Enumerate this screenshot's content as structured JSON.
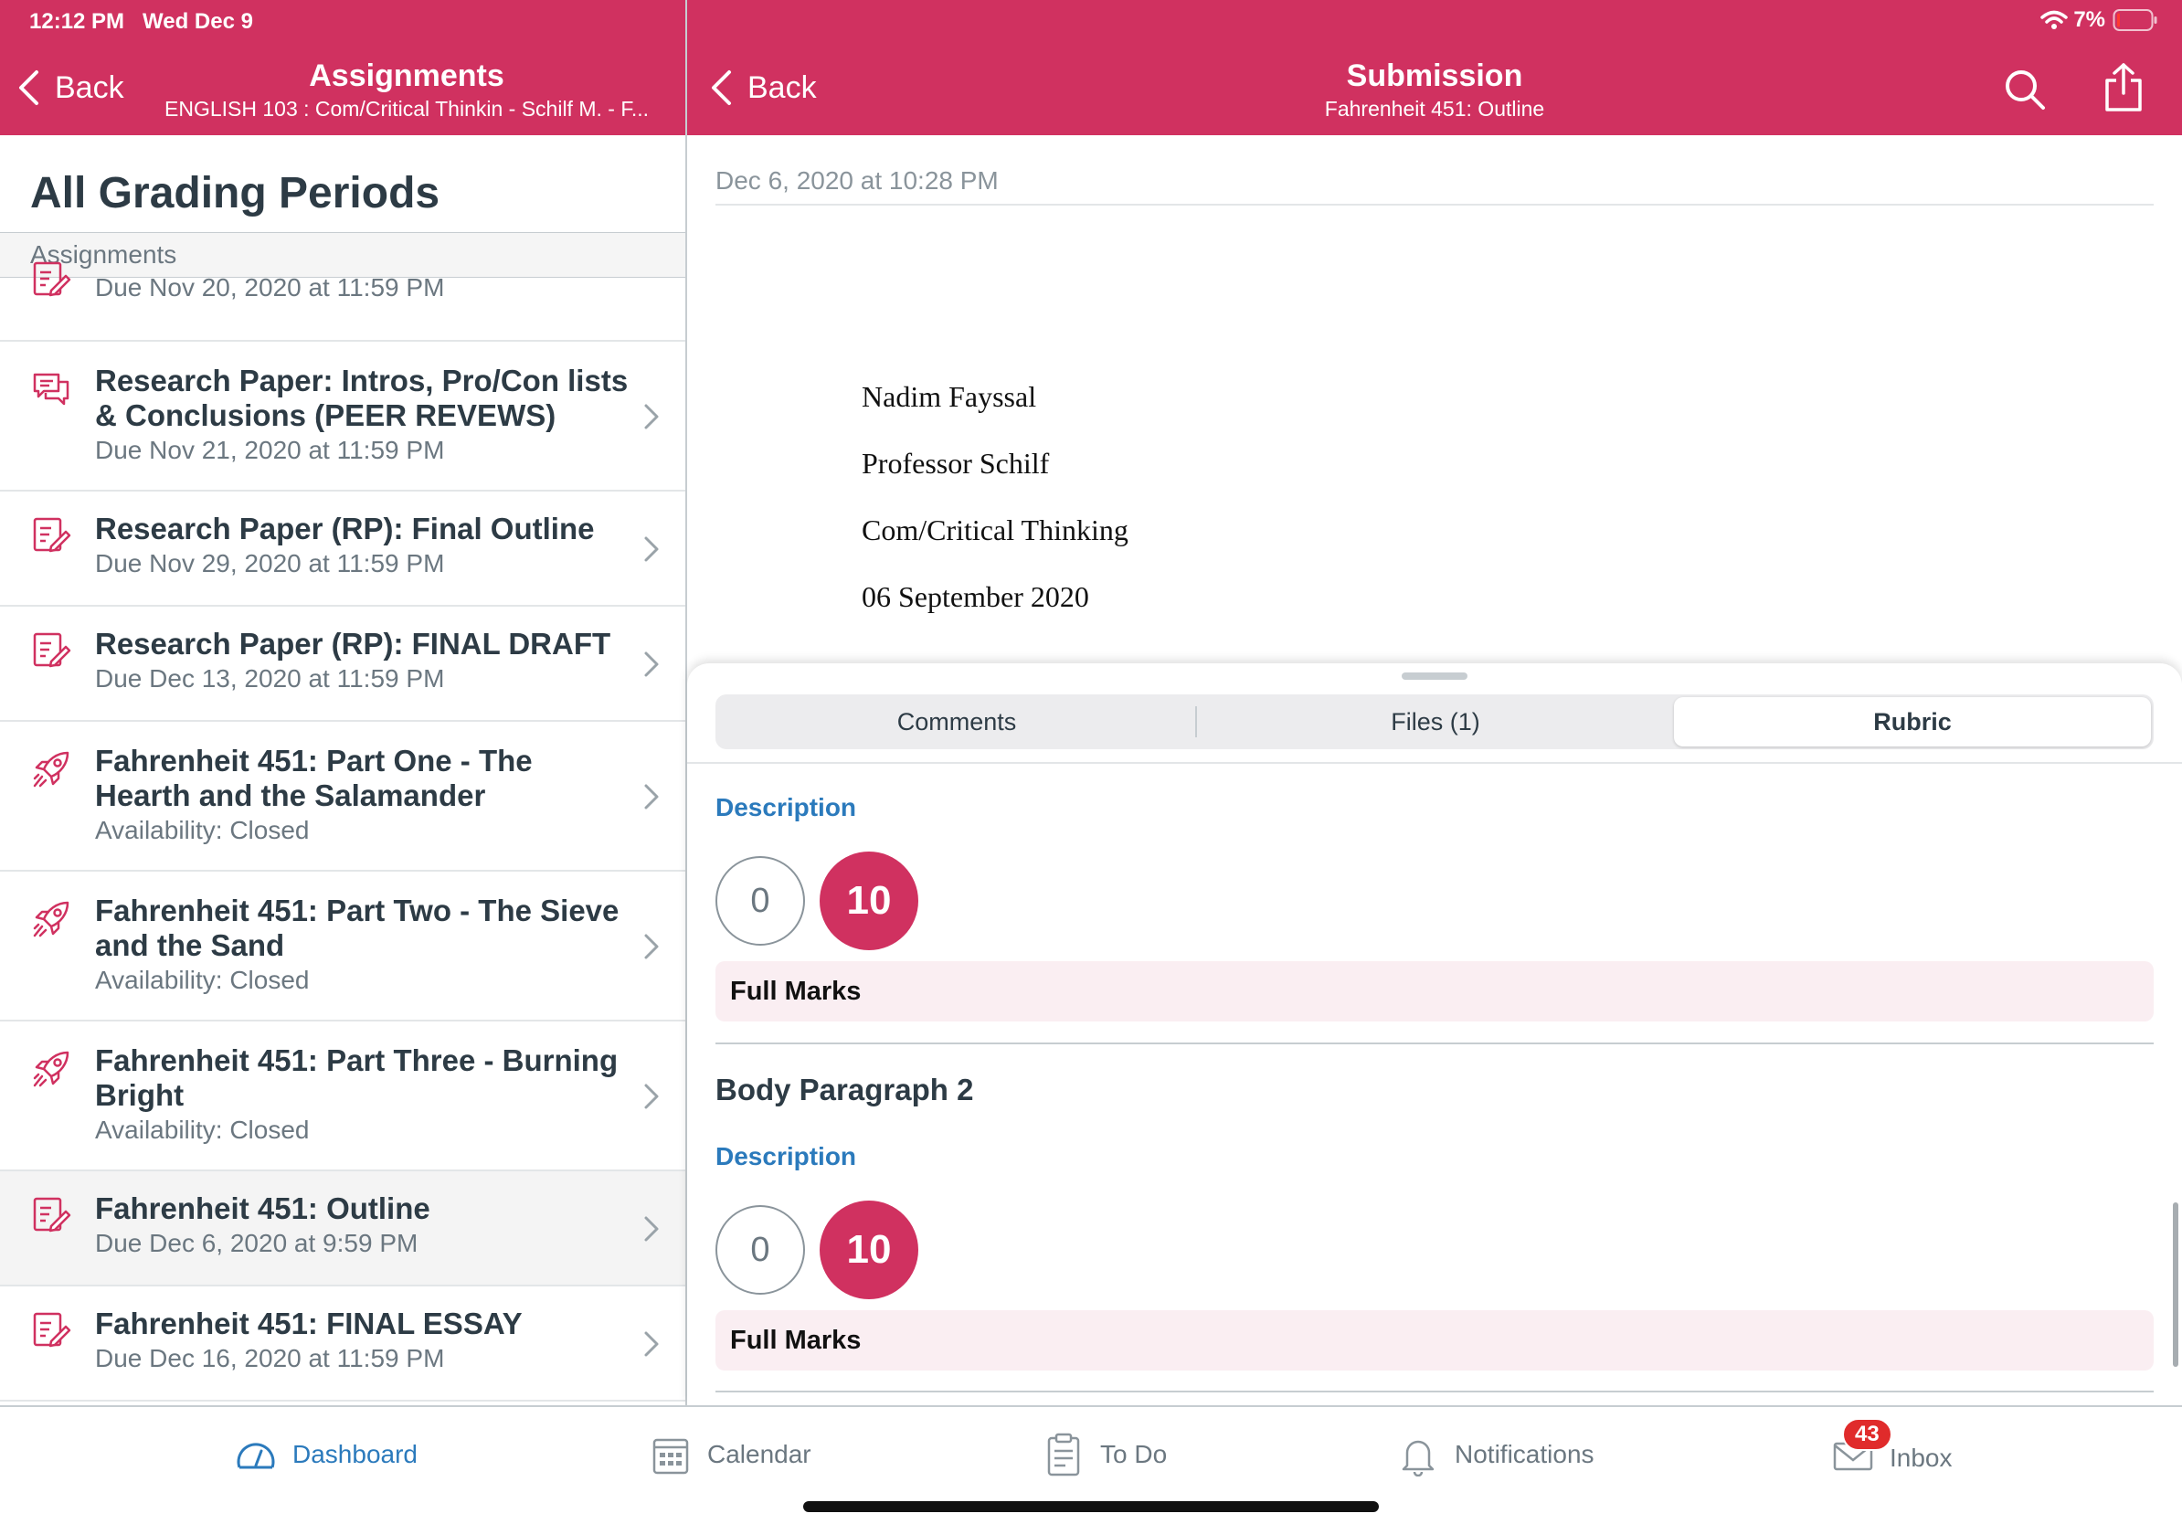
{
  "status": {
    "time": "12:12 PM",
    "date": "Wed Dec 9",
    "battery": "7%"
  },
  "left_header": {
    "back_label": "Back",
    "title": "Assignments",
    "subtitle": "ENGLISH 103 : Com/Critical Thinkin - Schilf M. - F..."
  },
  "right_header": {
    "back_label": "Back",
    "title": "Submission",
    "subtitle": "Fahrenheit 451: Outline"
  },
  "left_pane": {
    "title": "All Grading Periods",
    "section_label": "Assignments",
    "rows": [
      {
        "name": "",
        "meta": "Due Nov 20, 2020 at 11:59 PM",
        "icon": "assignment-icon"
      },
      {
        "name": "Research Paper: Intros, Pro/Con lists & Conclusions (PEER REVEWS)",
        "meta": "Due Nov 21, 2020 at 11:59 PM",
        "icon": "discussion-icon"
      },
      {
        "name": "Research Paper (RP): Final Outline",
        "meta": "Due Nov 29, 2020 at 11:59 PM",
        "icon": "assignment-icon"
      },
      {
        "name": "Research Paper (RP): FINAL DRAFT",
        "meta": "Due Dec 13, 2020 at 11:59 PM",
        "icon": "assignment-icon"
      },
      {
        "name": "Fahrenheit 451: Part One - The Hearth and the Salamander",
        "meta": "Availability: Closed",
        "icon": "quiz-rocket-icon"
      },
      {
        "name": "Fahrenheit 451: Part Two - The Sieve and the Sand",
        "meta": "Availability: Closed",
        "icon": "quiz-rocket-icon"
      },
      {
        "name": "Fahrenheit 451: Part Three - Burning Bright",
        "meta": "Availability: Closed",
        "icon": "quiz-rocket-icon"
      },
      {
        "name": "Fahrenheit 451: Outline",
        "meta": "Due Dec 6, 2020 at 9:59 PM",
        "icon": "assignment-icon",
        "selected": true
      },
      {
        "name": "Fahrenheit 451: FINAL ESSAY",
        "meta": "Due Dec 16, 2020 at 11:59 PM",
        "icon": "assignment-icon"
      }
    ]
  },
  "document": {
    "date": "Dec 6, 2020 at 10:28 PM",
    "lines": [
      "Nadim Fayssal",
      "Professor Schilf",
      "Com/Critical Thinking",
      "06 September 2020"
    ]
  },
  "drawer": {
    "tabs": [
      {
        "label": "Comments"
      },
      {
        "label": "Files (1)"
      },
      {
        "label": "Rubric",
        "active": true
      }
    ],
    "rubric": [
      {
        "title": "",
        "description_label": "Description",
        "scores": [
          "0",
          "10"
        ],
        "selected_score": "10",
        "rating": "Full Marks"
      },
      {
        "title": "Body Paragraph 2",
        "description_label": "Description",
        "scores": [
          "0",
          "10"
        ],
        "selected_score": "10",
        "rating": "Full Marks"
      }
    ]
  },
  "tabbar": {
    "items": [
      {
        "label": "Dashboard",
        "active": true
      },
      {
        "label": "Calendar"
      },
      {
        "label": "To Do"
      },
      {
        "label": "Notifications"
      },
      {
        "label": "Inbox",
        "badge": "43"
      }
    ]
  },
  "colors": {
    "brand": "#d03160",
    "link": "#2b7abc",
    "text": "#2d3b45",
    "muted": "#6b7780",
    "rating_bg": "#faeef2"
  }
}
